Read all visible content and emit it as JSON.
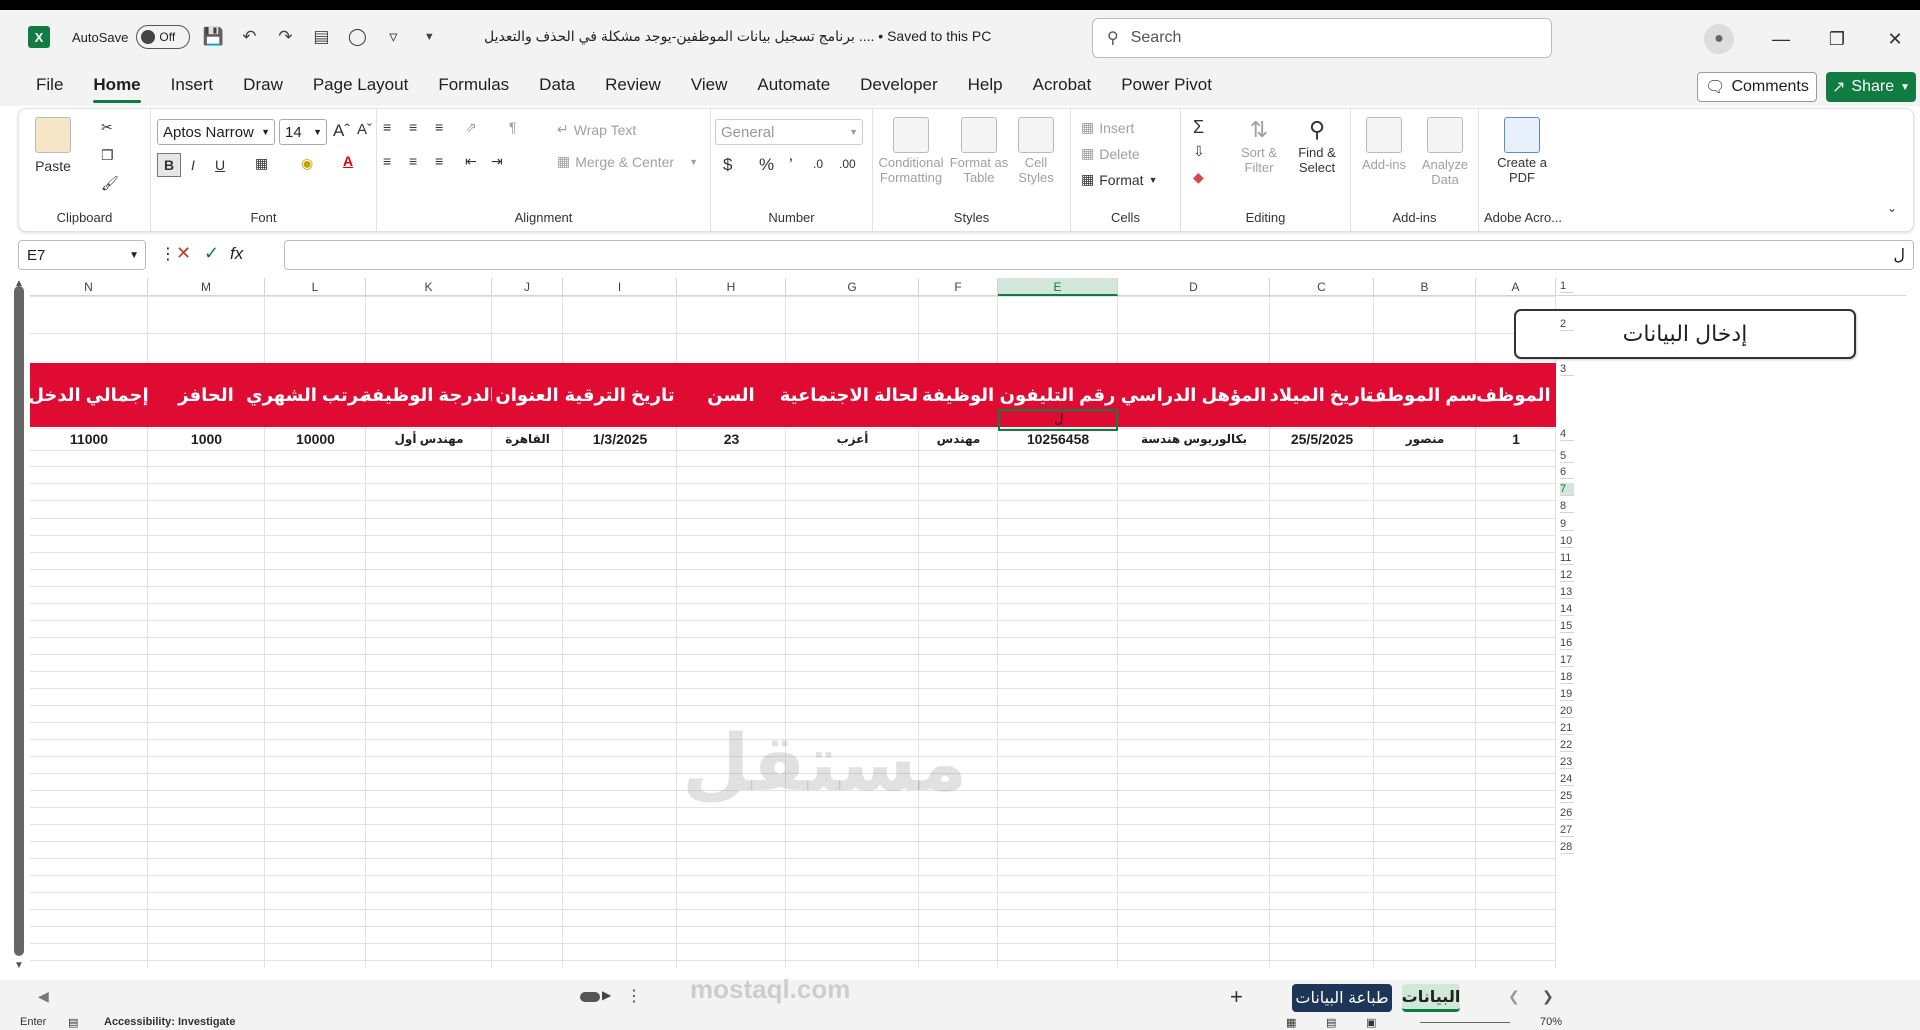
{
  "titlebar": {
    "autosave_label": "AutoSave",
    "autosave_state": "Off",
    "doc_title": "برنامج تسجيل بيانات الموظفين-يوجد مشكلة في الحذف والتعديل ....  •  Saved to this PC",
    "search_placeholder": "Search"
  },
  "menu": {
    "tabs": [
      "File",
      "Home",
      "Insert",
      "Draw",
      "Page Layout",
      "Formulas",
      "Data",
      "Review",
      "View",
      "Automate",
      "Developer",
      "Help",
      "Acrobat",
      "Power Pivot"
    ],
    "active": "Home",
    "comments": "Comments",
    "share": "Share"
  },
  "ribbon": {
    "clipboard": {
      "label": "Clipboard",
      "paste": "Paste"
    },
    "font": {
      "label": "Font",
      "name": "Aptos Narrow",
      "size": "14"
    },
    "alignment": {
      "label": "Alignment",
      "wrap": "Wrap Text",
      "merge": "Merge & Center"
    },
    "number": {
      "label": "Number",
      "format": "General"
    },
    "styles": {
      "label": "Styles",
      "conditional": "Conditional Formatting",
      "format_table": "Format as Table",
      "cell_styles": "Cell Styles"
    },
    "cells": {
      "label": "Cells",
      "insert": "Insert",
      "delete": "Delete",
      "format": "Format"
    },
    "editing": {
      "label": "Editing",
      "sort": "Sort & Filter",
      "find": "Find & Select"
    },
    "addins": {
      "label": "Add-ins",
      "addins": "Add-ins",
      "analyze": "Analyze Data"
    },
    "acrobat": {
      "label": "Adobe Acro...",
      "create": "Create a PDF"
    }
  },
  "formula_bar": {
    "name_box": "E7",
    "content": "",
    "fx": "fx"
  },
  "columns": [
    "N",
    "M",
    "L",
    "K",
    "J",
    "I",
    "H",
    "G",
    "F",
    "E",
    "D",
    "C",
    "B",
    "A"
  ],
  "rows": [
    "1",
    "2",
    "3",
    "4",
    "5",
    "6",
    "7",
    "8",
    "9",
    "10",
    "11",
    "12",
    "13",
    "14",
    "15",
    "16",
    "17",
    "18",
    "19",
    "20",
    "21",
    "22",
    "23",
    "24",
    "25",
    "26",
    "27",
    "28"
  ],
  "sheet": {
    "title_box": "إدخال البيانات",
    "headers": [
      "إجمالي الدخل",
      "الحافز",
      "المرتب الشهري",
      "الدرجة الوظيفة",
      "العنوان",
      "تاريخ الترقية",
      "السن",
      "الحالة الاجتماعية",
      "الوظيفة",
      "رقم التليفون",
      "المؤهل الدراسي",
      "تاريخ الميلاد",
      "اسم الموطف",
      "كود الموظف"
    ],
    "row4": [
      "11000",
      "1000",
      "10000",
      "مهندس أول",
      "القاهرة",
      "1/3/2025",
      "23",
      "أعزب",
      "مهندس",
      "10256458",
      "بكالوريوس هندسة",
      "25/5/2025",
      "منصور",
      "1"
    ],
    "cursor_char": "ل"
  },
  "tabs": {
    "print": "طباعة البيانات",
    "data": "البيانات"
  },
  "status": {
    "mode": "Enter",
    "accessibility": "Accessibility: Investigate",
    "zoom": "70%"
  },
  "watermark": {
    "arabic": "مستقل",
    "latin": "mostaql.com"
  },
  "colors": {
    "accent": "#107c41",
    "header_red": "#e00b32",
    "print_tab": "#1d3557"
  }
}
